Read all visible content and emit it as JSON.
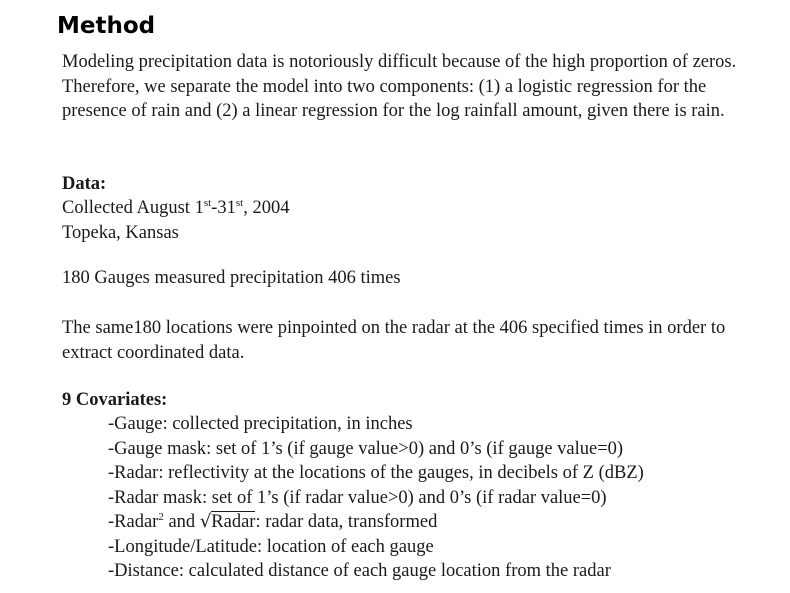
{
  "title": "Method",
  "intro": "Modeling precipitation data is notoriously difficult because of the high proportion of zeros. Therefore, we separate the model into two components: (1) a logistic regression for the presence of rain and (2) a linear regression for the log rainfall amount, given there is rain.",
  "data_section": {
    "heading": "Data:",
    "collected_prefix": "Collected August 1",
    "collected_sup1": "st",
    "collected_mid": "-31",
    "collected_sup2": "st",
    "collected_suffix": ", 2004",
    "location": "Topeka, Kansas"
  },
  "gauges_line": "180 Gauges measured precipitation 406 times",
  "locations_para": "The same180 locations were pinpointed on the radar at the 406 specified times in order to extract coordinated data.",
  "covariates": {
    "heading": "9 Covariates:",
    "items": [
      "-Gauge: collected precipitation, in inches",
      "-Gauge mask: set of  1’s (if  gauge value>0) and 0’s (if  gauge value=0)",
      "-Radar: reflectivity at the locations of  the gauges, in decibels of  Z (dBZ)",
      "-Radar mask: set of  1’s (if  radar value>0) and 0’s (if  radar value=0)"
    ],
    "radar_sq_prefix": "-Radar",
    "radar_sq_sup": "2",
    "radar_sq_and": " and ",
    "radar_sqrt_sign": "√",
    "radar_sqrt_term": "Radar",
    "radar_sq_suffix": ": radar data, transformed",
    "items_after": [
      "-Longitude/Latitude: location of  each gauge",
      "-Distance: calculated distance of  each gauge location from the radar"
    ]
  }
}
